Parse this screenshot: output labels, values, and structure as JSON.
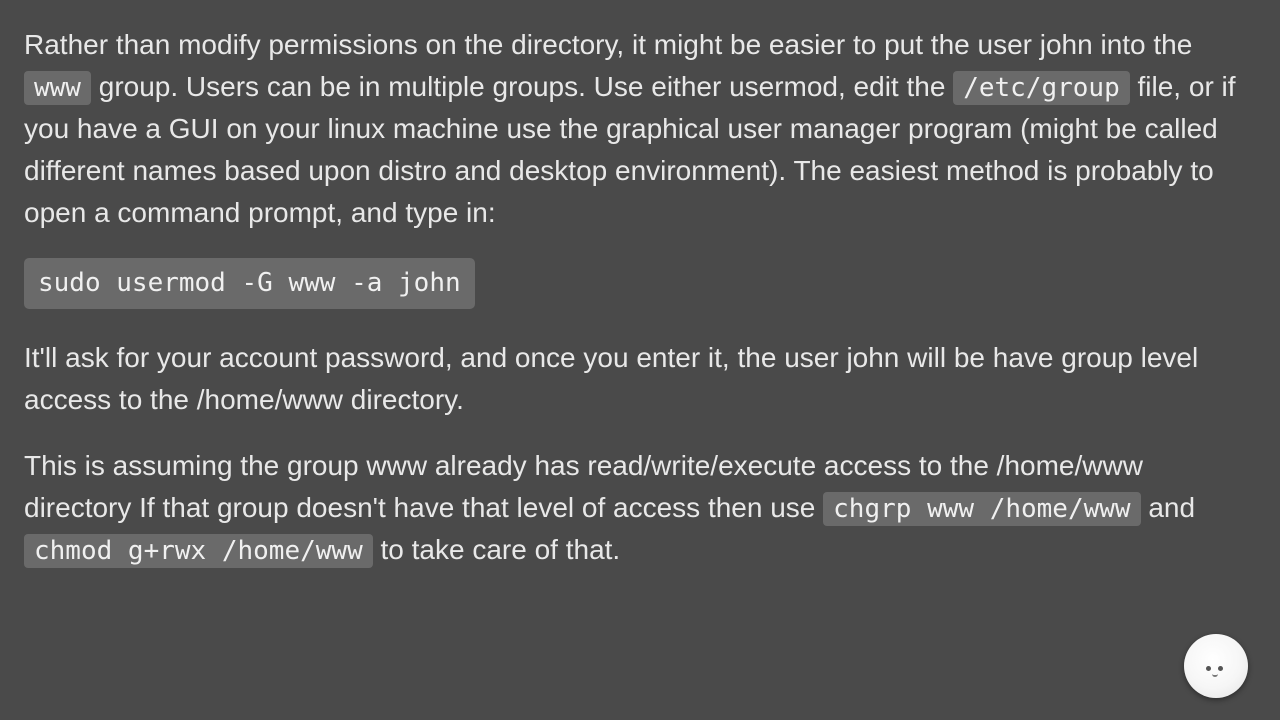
{
  "p1": {
    "t1": "Rather than modify permissions on the directory, it might be easier to put the user john into the ",
    "c1": "www",
    "t2": " group. Users can be in multiple groups. Use either usermod, edit the ",
    "c2": "/etc/group",
    "t3": " file, or if you have a GUI on your linux machine use the graphical user manager program (might be called different names based upon distro and desktop environment). The easiest method is probably to open a command prompt, and type in:"
  },
  "code1": "sudo usermod -G www -a john",
  "p2": "It'll ask for your account password, and once you enter it, the user john will be have group level access to the /home/www directory.",
  "p3": {
    "t1": "This is assuming the group www already has read/write/execute access to the /home/www directory If that group doesn't have that level of access then use ",
    "c1": "chgrp www /home/www",
    "t2": " and ",
    "c2": "chmod g+rwx /home/www",
    "t3": " to take care of that."
  }
}
